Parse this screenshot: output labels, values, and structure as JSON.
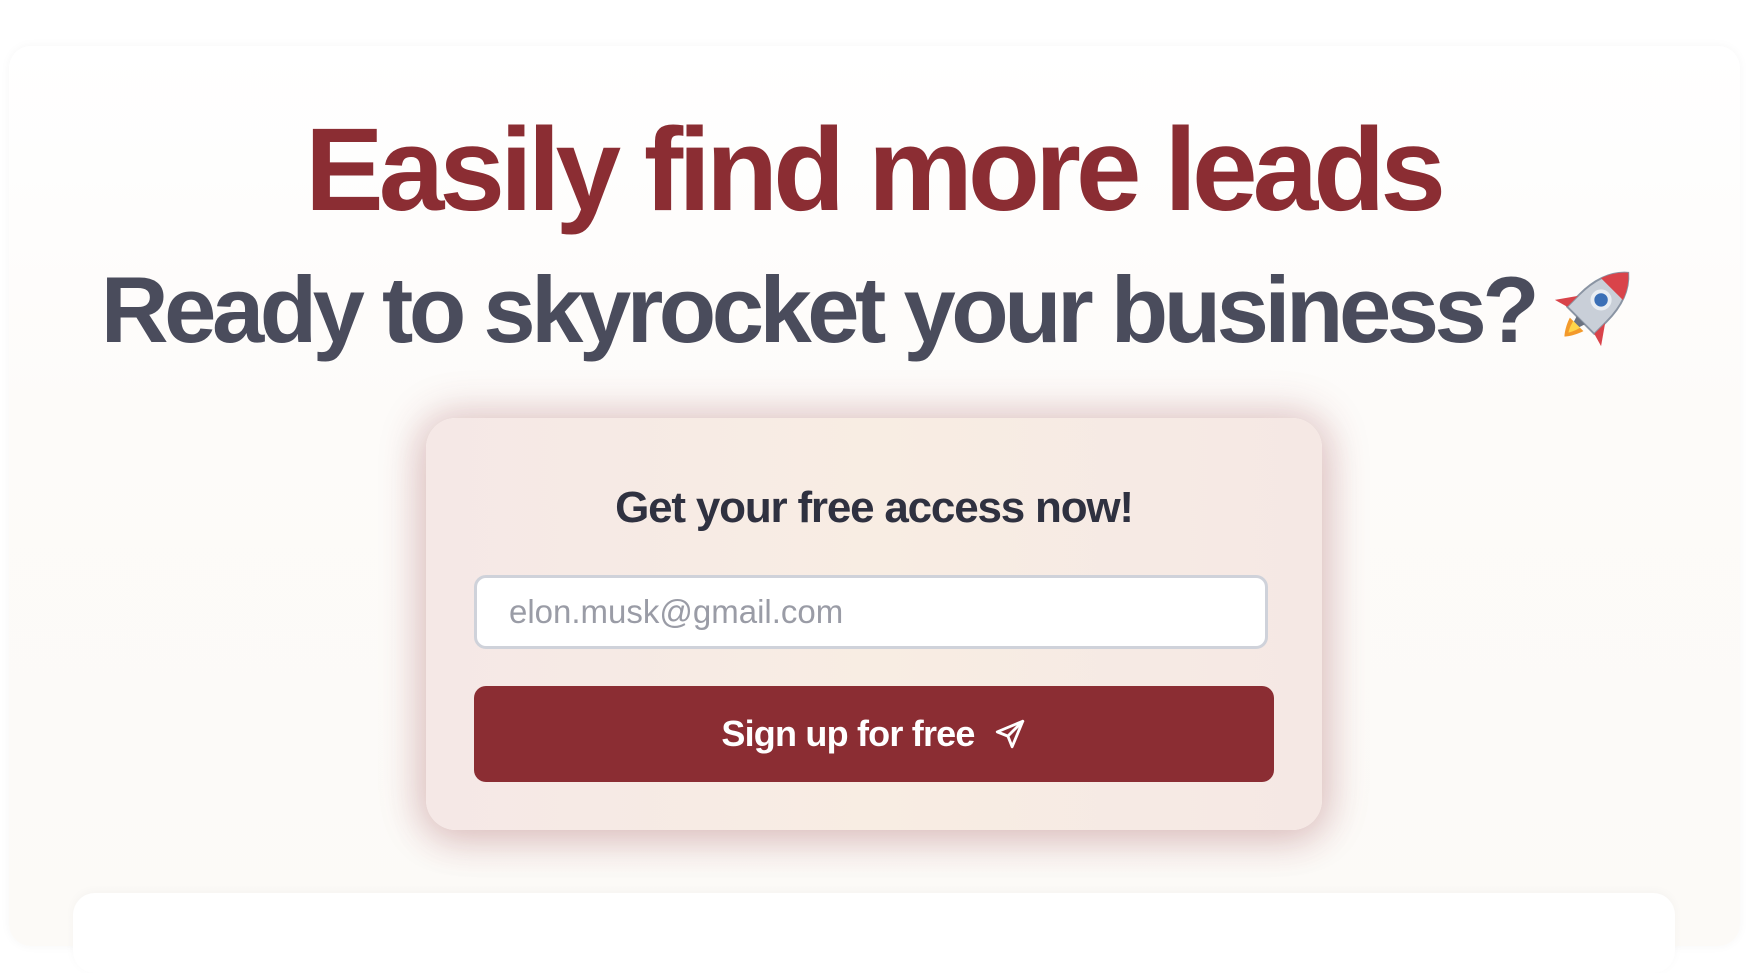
{
  "hero": {
    "headline": "Easily find more leads",
    "subheadline": "Ready to skyrocket your business?",
    "subheadline_icon": "rocket-icon"
  },
  "signup_card": {
    "title": "Get your free access now!",
    "email_placeholder": "elon.musk@gmail.com",
    "email_value": "",
    "button_label": "Sign up for free",
    "button_icon": "send-icon"
  },
  "colors": {
    "brand": "#8b2d33",
    "heading": "#4a4c5c",
    "card_title": "#2f3140",
    "placeholder": "#9a9ca6"
  }
}
